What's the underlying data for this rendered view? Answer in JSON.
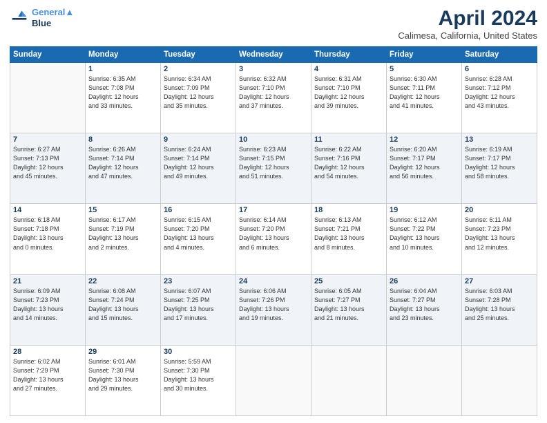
{
  "header": {
    "logo_line1": "General",
    "logo_line2": "Blue",
    "title": "April 2024",
    "subtitle": "Calimesa, California, United States"
  },
  "columns": [
    "Sunday",
    "Monday",
    "Tuesday",
    "Wednesday",
    "Thursday",
    "Friday",
    "Saturday"
  ],
  "weeks": [
    {
      "shade": false,
      "days": [
        {
          "num": "",
          "info": ""
        },
        {
          "num": "1",
          "info": "Sunrise: 6:35 AM\nSunset: 7:08 PM\nDaylight: 12 hours\nand 33 minutes."
        },
        {
          "num": "2",
          "info": "Sunrise: 6:34 AM\nSunset: 7:09 PM\nDaylight: 12 hours\nand 35 minutes."
        },
        {
          "num": "3",
          "info": "Sunrise: 6:32 AM\nSunset: 7:10 PM\nDaylight: 12 hours\nand 37 minutes."
        },
        {
          "num": "4",
          "info": "Sunrise: 6:31 AM\nSunset: 7:10 PM\nDaylight: 12 hours\nand 39 minutes."
        },
        {
          "num": "5",
          "info": "Sunrise: 6:30 AM\nSunset: 7:11 PM\nDaylight: 12 hours\nand 41 minutes."
        },
        {
          "num": "6",
          "info": "Sunrise: 6:28 AM\nSunset: 7:12 PM\nDaylight: 12 hours\nand 43 minutes."
        }
      ]
    },
    {
      "shade": true,
      "days": [
        {
          "num": "7",
          "info": "Sunrise: 6:27 AM\nSunset: 7:13 PM\nDaylight: 12 hours\nand 45 minutes."
        },
        {
          "num": "8",
          "info": "Sunrise: 6:26 AM\nSunset: 7:14 PM\nDaylight: 12 hours\nand 47 minutes."
        },
        {
          "num": "9",
          "info": "Sunrise: 6:24 AM\nSunset: 7:14 PM\nDaylight: 12 hours\nand 49 minutes."
        },
        {
          "num": "10",
          "info": "Sunrise: 6:23 AM\nSunset: 7:15 PM\nDaylight: 12 hours\nand 51 minutes."
        },
        {
          "num": "11",
          "info": "Sunrise: 6:22 AM\nSunset: 7:16 PM\nDaylight: 12 hours\nand 54 minutes."
        },
        {
          "num": "12",
          "info": "Sunrise: 6:20 AM\nSunset: 7:17 PM\nDaylight: 12 hours\nand 56 minutes."
        },
        {
          "num": "13",
          "info": "Sunrise: 6:19 AM\nSunset: 7:17 PM\nDaylight: 12 hours\nand 58 minutes."
        }
      ]
    },
    {
      "shade": false,
      "days": [
        {
          "num": "14",
          "info": "Sunrise: 6:18 AM\nSunset: 7:18 PM\nDaylight: 13 hours\nand 0 minutes."
        },
        {
          "num": "15",
          "info": "Sunrise: 6:17 AM\nSunset: 7:19 PM\nDaylight: 13 hours\nand 2 minutes."
        },
        {
          "num": "16",
          "info": "Sunrise: 6:15 AM\nSunset: 7:20 PM\nDaylight: 13 hours\nand 4 minutes."
        },
        {
          "num": "17",
          "info": "Sunrise: 6:14 AM\nSunset: 7:20 PM\nDaylight: 13 hours\nand 6 minutes."
        },
        {
          "num": "18",
          "info": "Sunrise: 6:13 AM\nSunset: 7:21 PM\nDaylight: 13 hours\nand 8 minutes."
        },
        {
          "num": "19",
          "info": "Sunrise: 6:12 AM\nSunset: 7:22 PM\nDaylight: 13 hours\nand 10 minutes."
        },
        {
          "num": "20",
          "info": "Sunrise: 6:11 AM\nSunset: 7:23 PM\nDaylight: 13 hours\nand 12 minutes."
        }
      ]
    },
    {
      "shade": true,
      "days": [
        {
          "num": "21",
          "info": "Sunrise: 6:09 AM\nSunset: 7:23 PM\nDaylight: 13 hours\nand 14 minutes."
        },
        {
          "num": "22",
          "info": "Sunrise: 6:08 AM\nSunset: 7:24 PM\nDaylight: 13 hours\nand 15 minutes."
        },
        {
          "num": "23",
          "info": "Sunrise: 6:07 AM\nSunset: 7:25 PM\nDaylight: 13 hours\nand 17 minutes."
        },
        {
          "num": "24",
          "info": "Sunrise: 6:06 AM\nSunset: 7:26 PM\nDaylight: 13 hours\nand 19 minutes."
        },
        {
          "num": "25",
          "info": "Sunrise: 6:05 AM\nSunset: 7:27 PM\nDaylight: 13 hours\nand 21 minutes."
        },
        {
          "num": "26",
          "info": "Sunrise: 6:04 AM\nSunset: 7:27 PM\nDaylight: 13 hours\nand 23 minutes."
        },
        {
          "num": "27",
          "info": "Sunrise: 6:03 AM\nSunset: 7:28 PM\nDaylight: 13 hours\nand 25 minutes."
        }
      ]
    },
    {
      "shade": false,
      "days": [
        {
          "num": "28",
          "info": "Sunrise: 6:02 AM\nSunset: 7:29 PM\nDaylight: 13 hours\nand 27 minutes."
        },
        {
          "num": "29",
          "info": "Sunrise: 6:01 AM\nSunset: 7:30 PM\nDaylight: 13 hours\nand 29 minutes."
        },
        {
          "num": "30",
          "info": "Sunrise: 5:59 AM\nSunset: 7:30 PM\nDaylight: 13 hours\nand 30 minutes."
        },
        {
          "num": "",
          "info": ""
        },
        {
          "num": "",
          "info": ""
        },
        {
          "num": "",
          "info": ""
        },
        {
          "num": "",
          "info": ""
        }
      ]
    }
  ]
}
